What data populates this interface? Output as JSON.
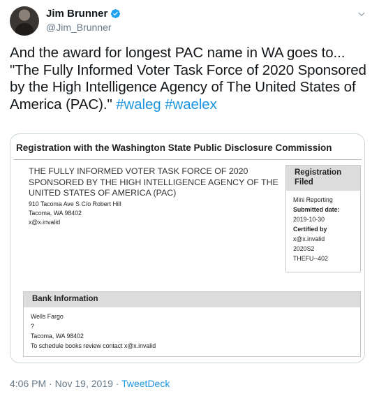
{
  "author": {
    "name": "Jim Brunner",
    "handle": "@Jim_Brunner"
  },
  "tweet": {
    "text_line1": "And the award for longest PAC name in WA goes to...",
    "text_main": "\"The Fully Informed Voter Task Force of 2020 Sponsored by the High Intelligence Agency of The United States of America (PAC).\"",
    "hashtags": [
      "#waleg",
      "#waelex"
    ]
  },
  "document": {
    "title": "Registration with the Washington State Public Disclosure Commission",
    "pac_name": "THE FULLY INFORMED VOTER TASK FORCE OF 2020 SPONSORED BY THE HIGH INTELLIGENCE AGENCY OF THE UNITED STATES OF AMERICA (PAC)",
    "address_lines": [
      "910 Tacoma Ave S C/o Robert Hill",
      "Tacoma, WA 98402",
      "x@x.invalid"
    ],
    "registration": {
      "heading": "Registration Filed",
      "lines": [
        {
          "text": "Mini Reporting",
          "bold": false
        },
        {
          "text": "Submitted date:",
          "bold": true
        },
        {
          "text": "2019-10-30",
          "bold": false
        },
        {
          "text": "Certified by",
          "bold": true
        },
        {
          "text": "x@x.invalid",
          "bold": false
        },
        {
          "text": "2020S2",
          "bold": false
        },
        {
          "text": "THEFU--402",
          "bold": false
        }
      ]
    },
    "bank": {
      "heading": "Bank Information",
      "lines": [
        "Wells Fargo",
        "?",
        "Tacoma, WA 98402",
        "To schedule books review contact x@x.invalid"
      ]
    }
  },
  "footer": {
    "time": "4:06 PM",
    "sep": " · ",
    "date": "Nov 19, 2019",
    "source": "TweetDeck"
  },
  "colors": {
    "link": "#1b95e0",
    "verified": "#1da1f2",
    "muted": "#657786"
  },
  "icons": [
    "verified-badge-icon",
    "chevron-down-icon"
  ]
}
